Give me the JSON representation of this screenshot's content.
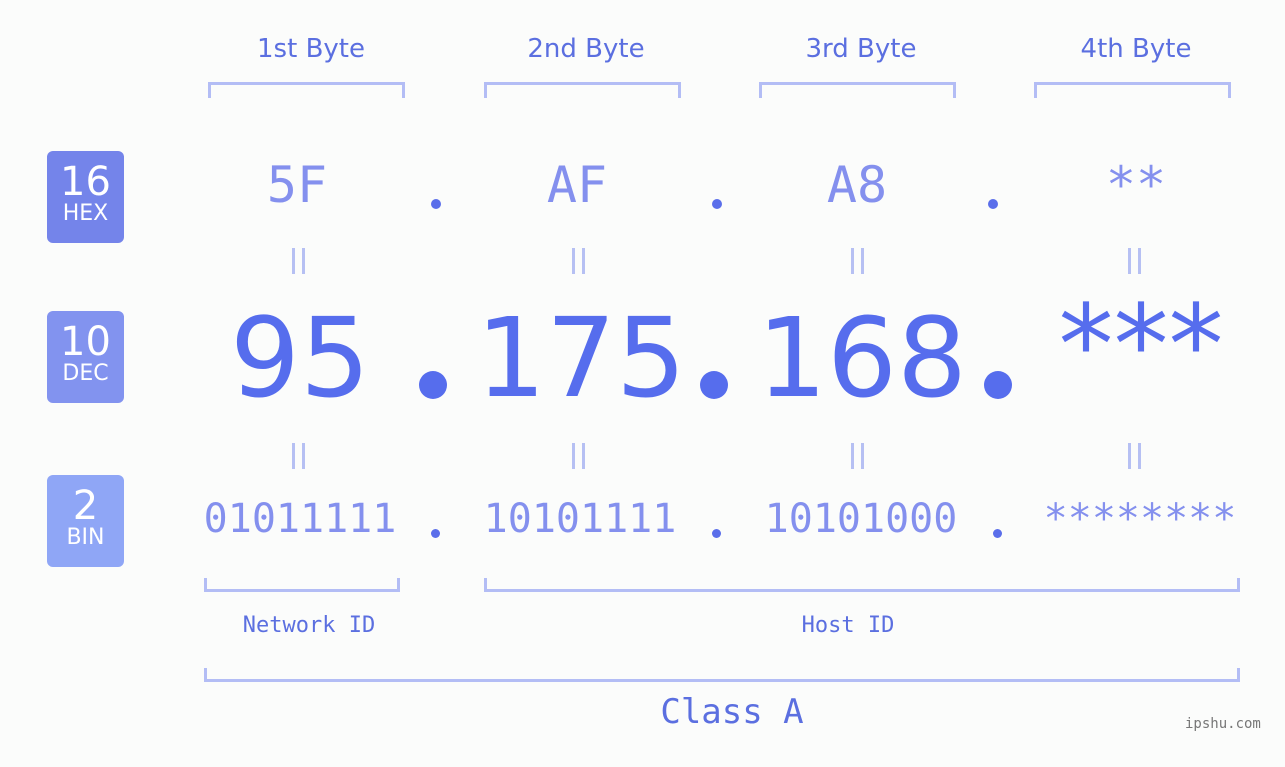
{
  "bytes": {
    "headers": [
      "1st Byte",
      "2nd Byte",
      "3rd Byte",
      "4th Byte"
    ]
  },
  "badges": {
    "hex": {
      "base": "16",
      "label": "HEX",
      "color": "#7484ea"
    },
    "dec": {
      "base": "10",
      "label": "DEC",
      "color": "#8293ef"
    },
    "bin": {
      "base": "2",
      "label": "BIN",
      "color": "#8fa6f6"
    }
  },
  "hex": [
    "5F",
    "AF",
    "A8",
    "**"
  ],
  "dec": [
    "95",
    "175",
    "168",
    "***"
  ],
  "bin": [
    "01011111",
    "10101111",
    "10101000",
    "********"
  ],
  "segments": {
    "network": "Network ID",
    "host": "Host ID",
    "class": "Class A"
  },
  "watermark": "ipshu.com",
  "colors": {
    "primary": "#566ded",
    "light": "#8490ee",
    "bracket": "#b3bdf5"
  }
}
